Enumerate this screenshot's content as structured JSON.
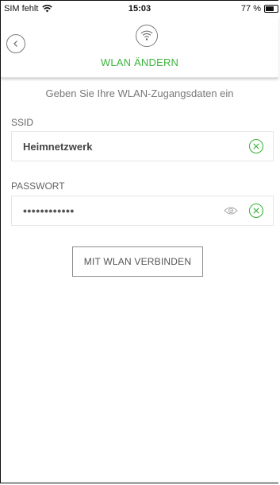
{
  "status_bar": {
    "carrier": "SIM fehlt",
    "time": "15:03",
    "battery": "77 %",
    "icons": [
      "wifi-signal-icon",
      "battery-icon"
    ]
  },
  "header": {
    "title": "WLAN ÄNDERN",
    "back_icon": "chevron-left-icon",
    "badge_icon": "wifi-icon",
    "accent_color": "#3db43d"
  },
  "main": {
    "intro_text": "Geben Sie Ihre WLAN-Zugangsdaten ein",
    "ssid": {
      "label": "SSID",
      "value": "Heimnetzwerk",
      "clear_icon": "clear-circle-icon"
    },
    "password": {
      "label": "PASSWORT",
      "value": "••••••••••••",
      "reveal_icon": "eye-icon",
      "clear_icon": "clear-circle-icon"
    },
    "connect_button_label": "MIT WLAN VERBINDEN"
  }
}
